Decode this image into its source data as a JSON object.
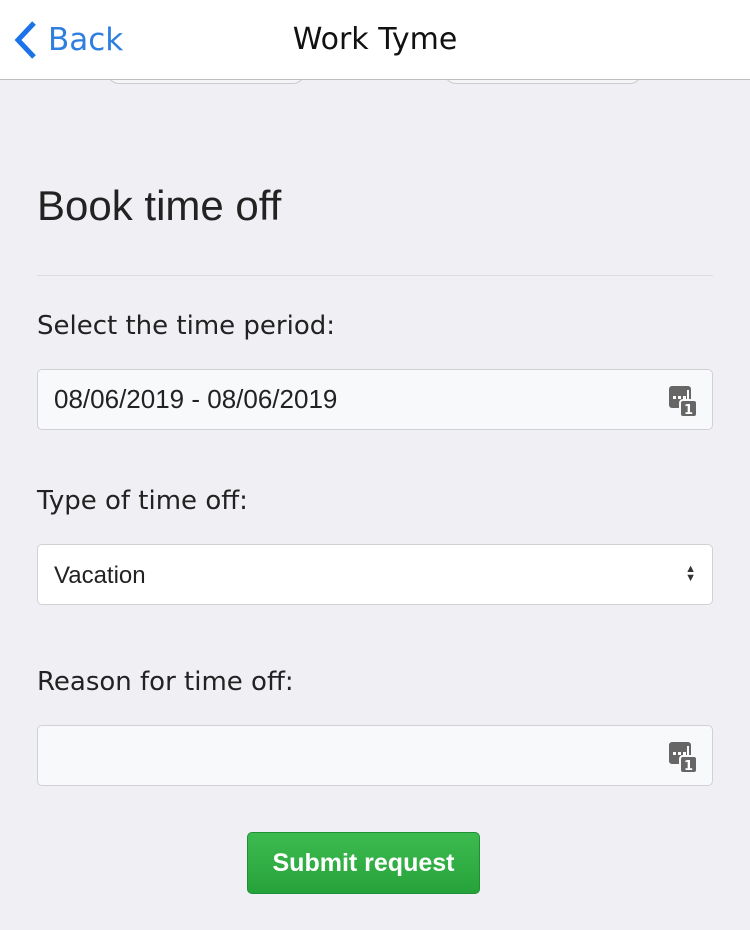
{
  "nav": {
    "back_label": "Back",
    "title": "Work Tyme"
  },
  "form": {
    "heading": "Book time off",
    "period_label": "Select the time period:",
    "period_value": "08/06/2019 - 08/06/2019",
    "type_label": "Type of time off:",
    "type_value": "Vacation",
    "reason_label": "Reason for time off:",
    "reason_value": "",
    "submit_label": "Submit request"
  },
  "colors": {
    "accent": "#2f7fe0",
    "submit": "#2fae44"
  },
  "icons": {
    "field_icon": "password-autofill-icon",
    "back": "chevron-left-icon",
    "select": "up-down-arrows-icon"
  }
}
